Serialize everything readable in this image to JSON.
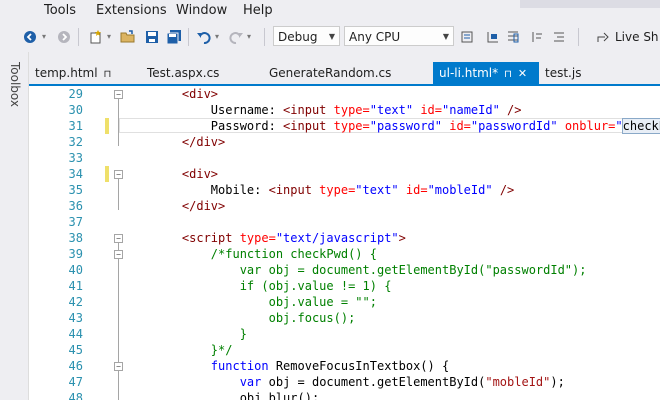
{
  "menu": {
    "items": [
      "Tools",
      "Extensions",
      "Window",
      "Help"
    ]
  },
  "toolbar": {
    "config_value": "Debug",
    "platform_value": "Any CPU",
    "run_label": "Live Sh"
  },
  "sidebar": {
    "toolbox_label": "Toolbox"
  },
  "tabs": [
    {
      "label": "temp.html",
      "pin": "⊓",
      "active": false
    },
    {
      "label": "Test.aspx.cs",
      "active": false
    },
    {
      "label": "GenerateRandom.cs",
      "active": false
    },
    {
      "label": "ul-li.html*",
      "pin": "⊓",
      "close": "✕",
      "active": true
    },
    {
      "label": "test.js",
      "active": false
    }
  ],
  "editor": {
    "lines": [
      {
        "n": "29",
        "fold": "⊟",
        "mod": false,
        "tokens": [
          [
            "    ",
            "text"
          ],
          [
            "<div>",
            "tag"
          ]
        ]
      },
      {
        "n": "30",
        "fold": "",
        "mod": false,
        "tokens": [
          [
            "        Username: ",
            "text"
          ],
          [
            "<input ",
            "tag"
          ],
          [
            "type=",
            "attr"
          ],
          [
            "\"text\"",
            "str"
          ],
          [
            " id=",
            "attr"
          ],
          [
            "\"nameId\"",
            "str"
          ],
          [
            " />",
            "tag"
          ]
        ]
      },
      {
        "n": "31",
        "fold": "",
        "mod": true,
        "tokens": [
          [
            "        Password: ",
            "text"
          ],
          [
            "<input ",
            "tag"
          ],
          [
            "type=",
            "attr"
          ],
          [
            "\"password\"",
            "str"
          ],
          [
            " id=",
            "attr"
          ],
          [
            "\"passwordId\"",
            "str"
          ],
          [
            " onblur=",
            "attr"
          ],
          [
            "\"",
            "str"
          ],
          [
            "checkPwd",
            "sel"
          ],
          [
            "()\"",
            "str"
          ]
        ]
      },
      {
        "n": "32",
        "fold": "",
        "mod": false,
        "tokens": [
          [
            "    ",
            "text"
          ],
          [
            "</div>",
            "tag"
          ]
        ]
      },
      {
        "n": "33",
        "fold": "",
        "mod": false,
        "tokens": []
      },
      {
        "n": "34",
        "fold": "⊟",
        "mod": true,
        "tokens": [
          [
            "    ",
            "text"
          ],
          [
            "<div>",
            "tag"
          ]
        ]
      },
      {
        "n": "35",
        "fold": "",
        "mod": false,
        "tokens": [
          [
            "        Mobile: ",
            "text"
          ],
          [
            "<input ",
            "tag"
          ],
          [
            "type=",
            "attr"
          ],
          [
            "\"text\"",
            "str"
          ],
          [
            " id=",
            "attr"
          ],
          [
            "\"mobleId\"",
            "str"
          ],
          [
            " />",
            "tag"
          ]
        ]
      },
      {
        "n": "36",
        "fold": "",
        "mod": false,
        "tokens": [
          [
            "    ",
            "text"
          ],
          [
            "</div>",
            "tag"
          ]
        ]
      },
      {
        "n": "37",
        "fold": "",
        "mod": false,
        "tokens": []
      },
      {
        "n": "38",
        "fold": "⊟",
        "mod": false,
        "tokens": [
          [
            "    ",
            "text"
          ],
          [
            "<script ",
            "tag"
          ],
          [
            "type=",
            "attr"
          ],
          [
            "\"text/javascript\"",
            "str"
          ],
          [
            ">",
            "tag"
          ]
        ]
      },
      {
        "n": "39",
        "fold": "⊟",
        "mod": false,
        "tokens": [
          [
            "        ",
            "text"
          ],
          [
            "/*function checkPwd() {",
            "cmt"
          ]
        ]
      },
      {
        "n": "40",
        "fold": "",
        "mod": false,
        "tokens": [
          [
            "            ",
            "text"
          ],
          [
            "var obj = document.getElementById(\"passwordId\");",
            "cmt"
          ]
        ]
      },
      {
        "n": "41",
        "fold": "",
        "mod": false,
        "tokens": [
          [
            "            ",
            "text"
          ],
          [
            "if (obj.value != 1) {",
            "cmt"
          ]
        ]
      },
      {
        "n": "42",
        "fold": "",
        "mod": false,
        "tokens": [
          [
            "                ",
            "text"
          ],
          [
            "obj.value = \"\";",
            "cmt"
          ]
        ]
      },
      {
        "n": "43",
        "fold": "",
        "mod": false,
        "tokens": [
          [
            "                ",
            "text"
          ],
          [
            "obj.focus();",
            "cmt"
          ]
        ]
      },
      {
        "n": "44",
        "fold": "",
        "mod": false,
        "tokens": [
          [
            "            ",
            "text"
          ],
          [
            "}",
            "cmt"
          ]
        ]
      },
      {
        "n": "45",
        "fold": "",
        "mod": false,
        "tokens": [
          [
            "        ",
            "text"
          ],
          [
            "}*/",
            "cmt"
          ]
        ]
      },
      {
        "n": "46",
        "fold": "⊟",
        "mod": false,
        "tokens": [
          [
            "        ",
            "text"
          ],
          [
            "function",
            "kw"
          ],
          [
            " RemoveFocusInTextbox() {",
            "id"
          ]
        ]
      },
      {
        "n": "47",
        "fold": "",
        "mod": false,
        "tokens": [
          [
            "            ",
            "text"
          ],
          [
            "var",
            "kw"
          ],
          [
            " obj = document.getElementById(",
            "id"
          ],
          [
            "\"mobleId\"",
            "jsstr"
          ],
          [
            ");",
            "id"
          ]
        ]
      },
      {
        "n": "48",
        "fold": "",
        "mod": false,
        "tokens": [
          [
            "            ",
            "text"
          ],
          [
            "obj.blur();",
            "id"
          ]
        ]
      }
    ]
  }
}
